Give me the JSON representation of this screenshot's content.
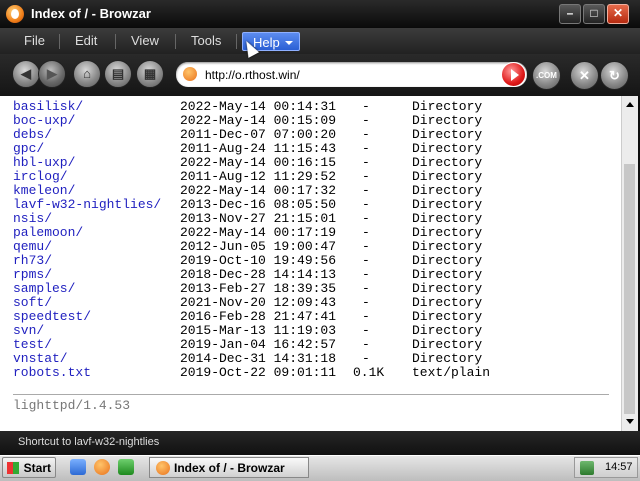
{
  "window": {
    "title": "Index of / - Browzar"
  },
  "titlebar_buttons": {
    "minimize": "–",
    "maximize": "□",
    "close": "✕"
  },
  "menu": [
    {
      "label": "File"
    },
    {
      "label": "Edit"
    },
    {
      "label": "View"
    },
    {
      "label": "Tools"
    },
    {
      "label": "Help",
      "active": true
    }
  ],
  "toolbar": {
    "back": "◀",
    "forward": "▶",
    "home": "⌂",
    "print": "▤",
    "favorites": "▦",
    "url": "http://o.rthost.win/",
    "com_label": ".COM",
    "stop": "✕",
    "refresh": "↻"
  },
  "listing": [
    {
      "name": "basilisk/",
      "date": "2022-May-14 00:14:31",
      "size": "-",
      "type": "Directory"
    },
    {
      "name": "boc-uxp/",
      "date": "2022-May-14 00:15:09",
      "size": "-",
      "type": "Directory"
    },
    {
      "name": "debs/",
      "date": "2011-Dec-07 07:00:20",
      "size": "-",
      "type": "Directory"
    },
    {
      "name": "gpc/",
      "date": "2011-Aug-24 11:15:43",
      "size": "-",
      "type": "Directory"
    },
    {
      "name": "hbl-uxp/",
      "date": "2022-May-14 00:16:15",
      "size": "-",
      "type": "Directory"
    },
    {
      "name": "irclog/",
      "date": "2011-Aug-12 11:29:52",
      "size": "-",
      "type": "Directory"
    },
    {
      "name": "kmeleon/",
      "date": "2022-May-14 00:17:32",
      "size": "-",
      "type": "Directory"
    },
    {
      "name": "lavf-w32-nightlies/",
      "date": "2013-Dec-16 08:05:50",
      "size": "-",
      "type": "Directory"
    },
    {
      "name": "nsis/",
      "date": "2013-Nov-27 21:15:01",
      "size": "-",
      "type": "Directory"
    },
    {
      "name": "palemoon/",
      "date": "2022-May-14 00:17:19",
      "size": "-",
      "type": "Directory"
    },
    {
      "name": "qemu/",
      "date": "2012-Jun-05 19:00:47",
      "size": "-",
      "type": "Directory"
    },
    {
      "name": "rh73/",
      "date": "2019-Oct-10 19:49:56",
      "size": "-",
      "type": "Directory"
    },
    {
      "name": "rpms/",
      "date": "2018-Dec-28 14:14:13",
      "size": "-",
      "type": "Directory"
    },
    {
      "name": "samples/",
      "date": "2013-Feb-27 18:39:35",
      "size": "-",
      "type": "Directory"
    },
    {
      "name": "soft/",
      "date": "2021-Nov-20 12:09:43",
      "size": "-",
      "type": "Directory"
    },
    {
      "name": "speedtest/",
      "date": "2016-Feb-28 21:47:41",
      "size": "-",
      "type": "Directory"
    },
    {
      "name": "svn/",
      "date": "2015-Mar-13 11:19:03",
      "size": "-",
      "type": "Directory"
    },
    {
      "name": "test/",
      "date": "2019-Jan-04 16:42:57",
      "size": "-",
      "type": "Directory"
    },
    {
      "name": "vnstat/",
      "date": "2014-Dec-31 14:31:18",
      "size": "-",
      "type": "Directory"
    },
    {
      "name": "robots.txt",
      "date": "2019-Oct-22 09:01:11",
      "size": "0.1K",
      "type": "text/plain"
    }
  ],
  "footer": "lighttpd/1.4.53",
  "status": "Shortcut to lavf-w32-nightlies",
  "taskbar": {
    "start_label": "Start",
    "task_label": "Index of / - Browzar",
    "clock": "14:57"
  },
  "colors": {
    "link": "#1f1fbf",
    "chrome": "#1a1a1a",
    "help_menu": "#2b5fd4",
    "go_button": "#e01a1a"
  }
}
